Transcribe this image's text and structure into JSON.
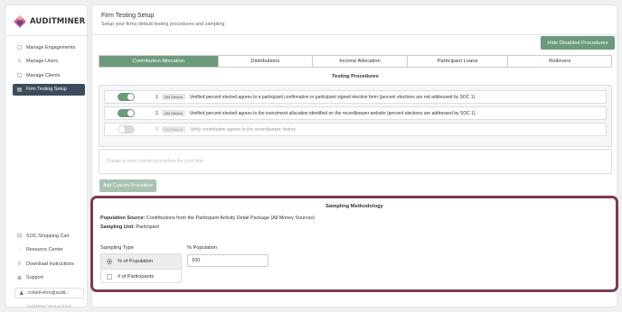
{
  "brand": {
    "name": "AUDITMINER",
    "accent": "#6b9a7c",
    "mark_colors": [
      "#e0627c",
      "#5a4a8c"
    ]
  },
  "sidebar": {
    "nav": [
      {
        "label": "Manage Engagements",
        "icon": "briefcase-icon",
        "glyph": "▢"
      },
      {
        "label": "Manage Users",
        "icon": "users-icon",
        "glyph": "☺"
      },
      {
        "label": "Manage Clients",
        "icon": "clients-icon",
        "glyph": "▢"
      },
      {
        "label": "Firm Testing Setup",
        "icon": "settings-icon",
        "glyph": "▤",
        "active": true
      }
    ],
    "bottom": [
      {
        "label": "SOC Shopping Cart",
        "icon": "cart-icon",
        "glyph": "⊡"
      },
      {
        "label": "Resource Center",
        "icon": "lightbulb-icon",
        "glyph": "◌"
      },
      {
        "label": "Download Instructions",
        "icon": "download-icon",
        "glyph": "⇩"
      },
      {
        "label": "Support",
        "icon": "globe-icon",
        "glyph": "⊕"
      }
    ],
    "user": "corbell+firm@audit...",
    "version": "AuditMiner Version 0.5.0"
  },
  "page": {
    "title": "Firm Testing Setup",
    "subtitle": "Setup your firms default testing procedures and sampling"
  },
  "hide_button": "Hide Disabled Procedures",
  "tabs": [
    {
      "label": "Contribution Allocation",
      "active": true
    },
    {
      "label": "Distributions"
    },
    {
      "label": "Income Allocation"
    },
    {
      "label": "Participant Loans"
    },
    {
      "label": "Rollovers"
    }
  ],
  "procedures": {
    "heading": "Testing Procedures",
    "badge": "AM Default",
    "items": [
      {
        "num": "1.",
        "enabled": true,
        "text": "Verified percent elected agrees to a participant confirmation or participant signed election form (percent elections are not addressed by SOC 1)."
      },
      {
        "num": "2.",
        "enabled": true,
        "text": "Verified percent elected agrees to the investment allocation identified on the recordkeeper website (percent elections are addressed by SOC 1)."
      },
      {
        "num": "3.",
        "enabled": false,
        "text": "Verify contribution agrees to the recordkeeper history"
      }
    ],
    "new_placeholder": "Create a new custom procedure for your firm",
    "add_button": "Add Custom Procedure"
  },
  "sampling": {
    "heading": "Sampling Methodology",
    "population_source_label": "Population Source:",
    "population_source_value": "Contributions from the Participant Activity Detail Package (All Money Sources)",
    "sampling_unit_label": "Sampling Unit:",
    "sampling_unit_value": "Participant",
    "type_label": "Sampling Type",
    "options": [
      {
        "label": "% of Population",
        "selected": true
      },
      {
        "label": "# of Participants",
        "selected": false
      }
    ],
    "pct_label": "% Population",
    "pct_value": "100"
  }
}
